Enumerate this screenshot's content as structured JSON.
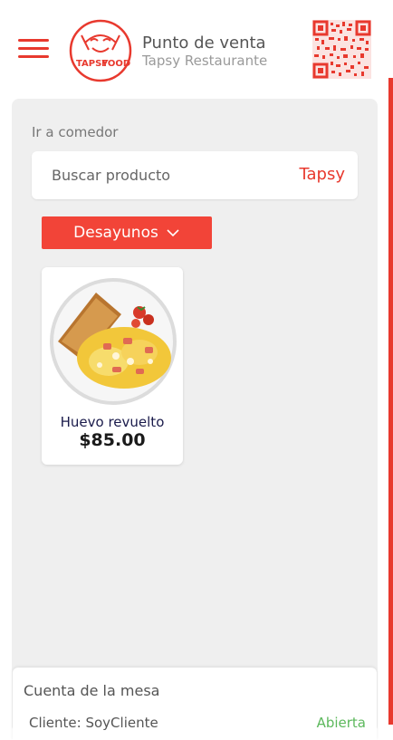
{
  "header": {
    "title": "Punto de venta",
    "subtitle": "Tapsy Restaurante",
    "logo_text_left": "TAPSY",
    "logo_text_right": "FOOD"
  },
  "main": {
    "section_label": "Ir a comedor",
    "search": {
      "placeholder": "Buscar producto",
      "brand": "Tapsy"
    },
    "category": {
      "label": "Desayunos",
      "icon": "chevron-down-icon"
    },
    "products": [
      {
        "name": "Huevo revuelto",
        "price": "$85.00"
      }
    ]
  },
  "bill": {
    "title": "Cuenta de la mesa",
    "client": "Cliente: SoyCliente",
    "status": "Abierta"
  },
  "colors": {
    "accent": "#e8392e",
    "category_bg": "#f24438",
    "status_open": "#5cb85c"
  }
}
